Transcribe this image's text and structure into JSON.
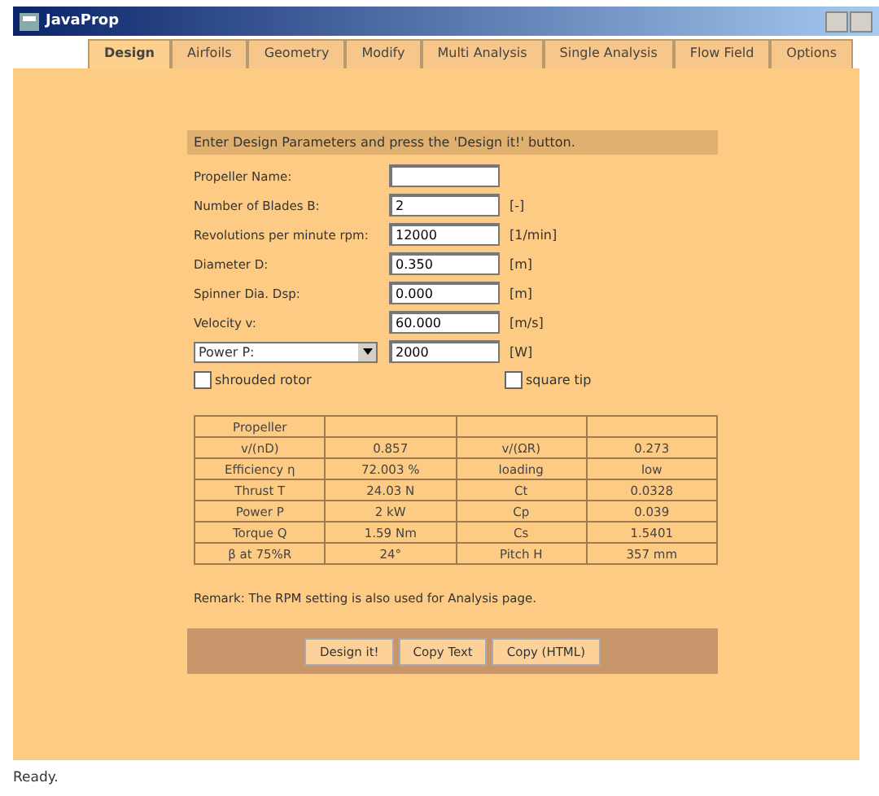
{
  "window": {
    "title": "JavaProp"
  },
  "tabs": [
    {
      "label": "Design",
      "selected": true
    },
    {
      "label": "Airfoils",
      "selected": false
    },
    {
      "label": "Geometry",
      "selected": false
    },
    {
      "label": "Modify",
      "selected": false
    },
    {
      "label": "Multi Analysis",
      "selected": false
    },
    {
      "label": "Single Analysis",
      "selected": false
    },
    {
      "label": "Flow Field",
      "selected": false
    },
    {
      "label": "Options",
      "selected": false
    }
  ],
  "instruction": "Enter Design Parameters and press the 'Design it!' button.",
  "fields": [
    {
      "kind": "text",
      "label": "Propeller Name:"
    },
    {
      "kind": "text",
      "label": "Number of Blades  B:",
      "value": "2",
      "unit": "[-]"
    },
    {
      "kind": "text",
      "label": "Revolutions per minute  rpm:",
      "value": "12000",
      "unit": "[1/min]"
    },
    {
      "kind": "text",
      "label": "Diameter  D:",
      "value": "0.350",
      "unit": "[m]"
    },
    {
      "kind": "text",
      "label": "Spinner Dia.  Dsp:",
      "value": "0.000",
      "unit": "[m]"
    },
    {
      "kind": "text",
      "label": "Velocity  v:",
      "value": "60.000",
      "unit": "[m/s]"
    },
    {
      "kind": "select",
      "label": "Power  P:",
      "value": "2000",
      "unit": "[W]"
    }
  ],
  "checkboxes": [
    {
      "label": "shrouded rotor",
      "checked": false
    },
    {
      "label": "square tip",
      "checked": false
    }
  ],
  "table": {
    "rows": [
      [
        "Propeller",
        "",
        "",
        ""
      ],
      [
        "v/(nD)",
        "0.857",
        "v/(ΩR)",
        "0.273"
      ],
      [
        "Efficiency η",
        "72.003 %",
        "loading",
        "low"
      ],
      [
        "Thrust  T",
        "24.03 N",
        "Ct",
        "0.0328"
      ],
      [
        "Power  P",
        "2 kW",
        "Cp",
        "0.039"
      ],
      [
        "Torque  Q",
        "1.59 Nm",
        "Cs",
        "1.5401"
      ],
      [
        "β at 75%R",
        "24°",
        "Pitch H",
        "357 mm"
      ]
    ]
  },
  "remark": "Remark: The RPM setting is also used for Analysis page.",
  "buttons": [
    "Design it!",
    "Copy Text",
    "Copy (HTML)"
  ],
  "status_bar": "Ready."
}
